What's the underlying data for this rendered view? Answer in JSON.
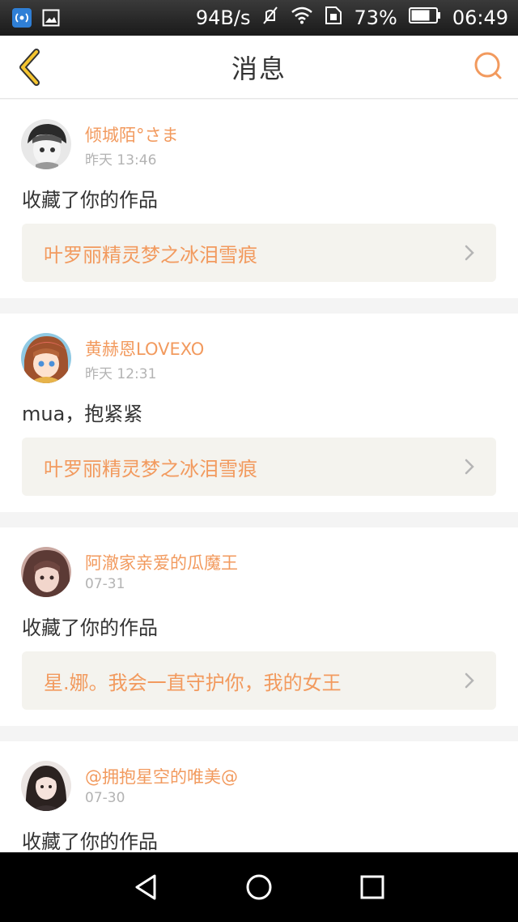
{
  "status_bar": {
    "speed": "94B/s",
    "battery": "73%",
    "time": "06:49",
    "icons": [
      "app-notification-icon",
      "image-notification-icon",
      "mute-icon",
      "wifi-icon",
      "sim-icon",
      "battery-icon"
    ]
  },
  "header": {
    "title": "消息",
    "back_icon": "chevron-left-icon",
    "search_icon": "search-icon",
    "accent": "#f29a5e"
  },
  "messages": [
    {
      "username": "倾城陌°さま",
      "time": "昨天 13:46",
      "text": "收藏了你的作品",
      "work": "叶罗丽精灵梦之冰泪雪痕"
    },
    {
      "username": "黄赫恩LOVEXO",
      "time": "昨天 12:31",
      "text": "mua，抱紧紧",
      "work": "叶罗丽精灵梦之冰泪雪痕"
    },
    {
      "username": "阿澈家亲爱的瓜魔王",
      "time": "07-31",
      "text": "收藏了你的作品",
      "work": "星.娜。我会一直守护你，我的女王"
    },
    {
      "username": "@拥抱星空的唯美@",
      "time": "07-30",
      "text": "收藏了你的作品"
    }
  ],
  "nav_bar": {
    "back": "triangle-back-icon",
    "home": "circle-home-icon",
    "recents": "square-recents-icon"
  }
}
